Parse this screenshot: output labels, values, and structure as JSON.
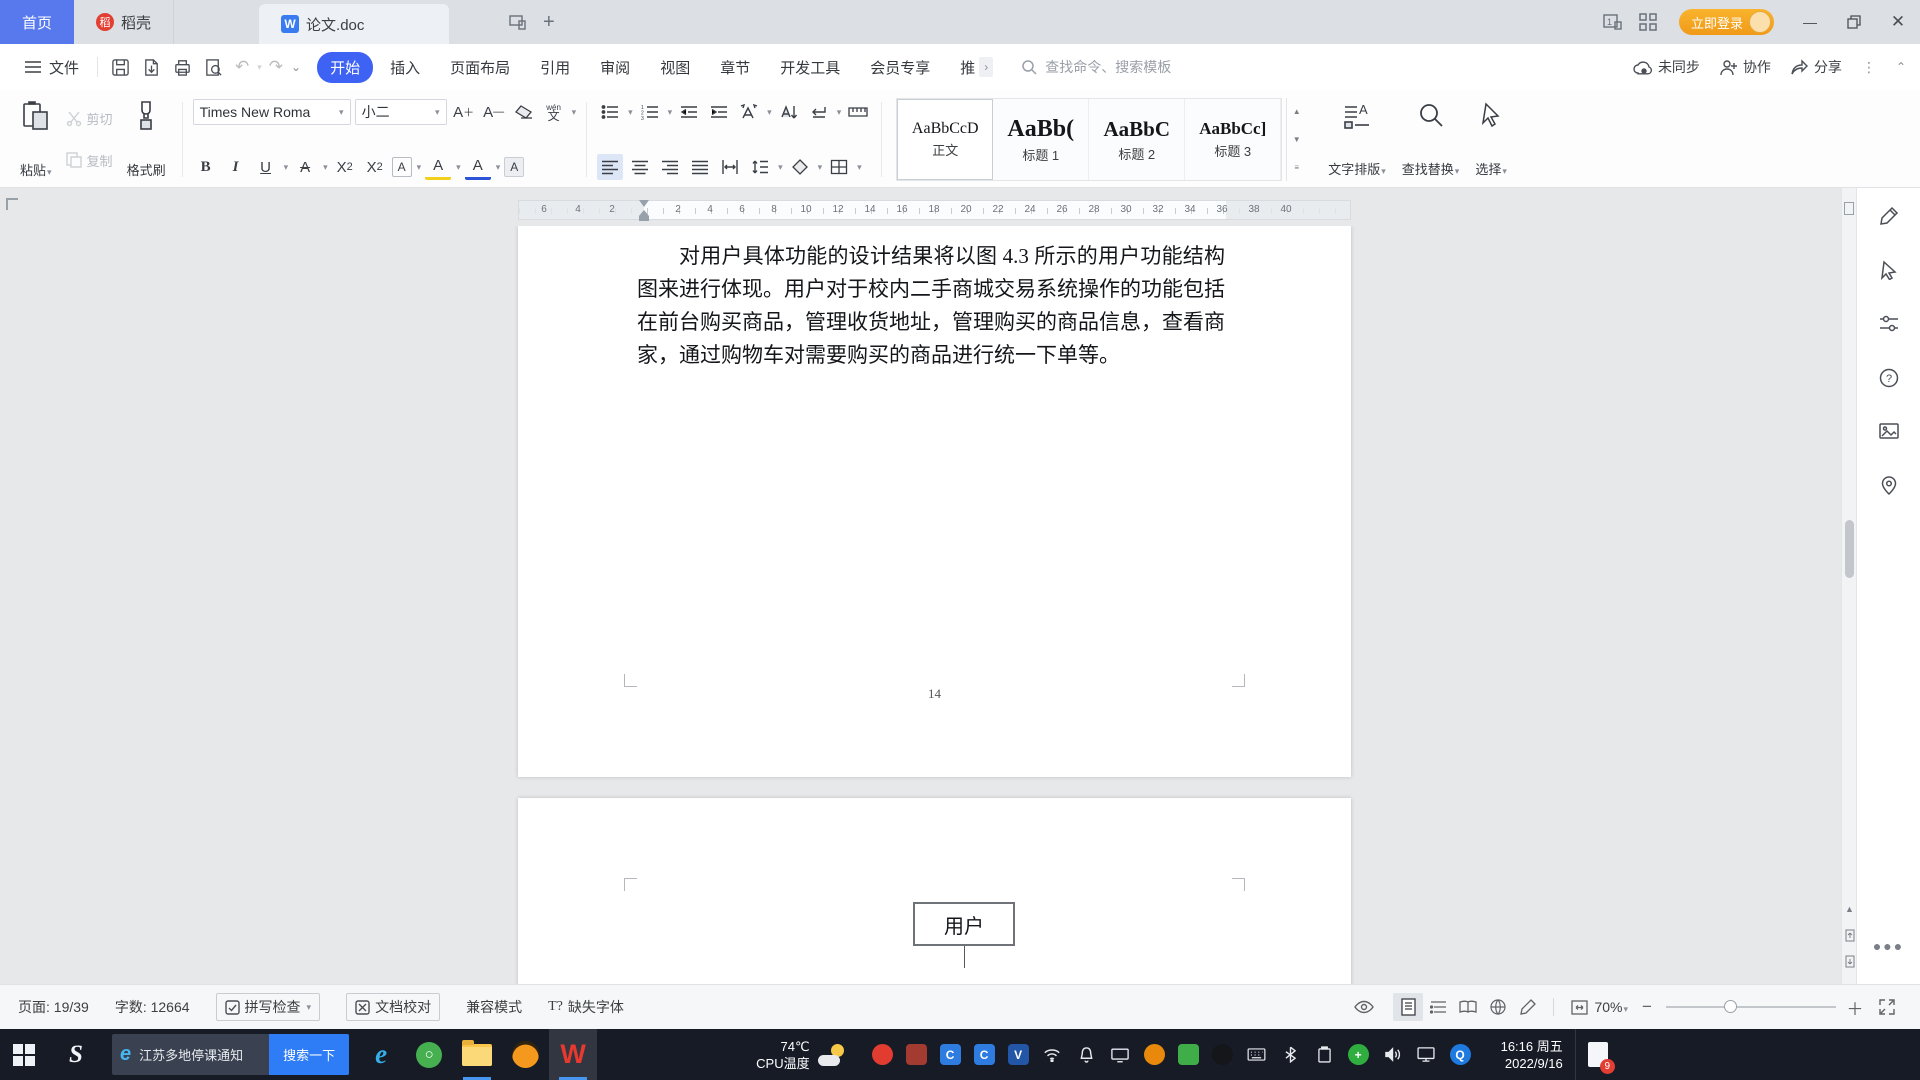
{
  "titlebar": {
    "home_tab": "首页",
    "docer_tab": "稻壳",
    "doc_tab": "论文.doc",
    "login_label": "立即登录"
  },
  "menubar": {
    "file_label": "文件",
    "tabs": [
      "开始",
      "插入",
      "页面布局",
      "引用",
      "审阅",
      "视图",
      "章节",
      "开发工具",
      "会员专享",
      "推"
    ],
    "active_tab": "开始",
    "overflow_indicator": "›",
    "search_placeholder": "查找命令、搜索模板",
    "sync_label": "未同步",
    "collab_label": "协作",
    "share_label": "分享"
  },
  "ribbon": {
    "paste_label": "粘贴",
    "cut_label": "剪切",
    "copy_label": "复制",
    "format_painter_label": "格式刷",
    "font_name": "Times New Roma",
    "font_size": "小二",
    "styles": [
      {
        "preview": "AaBbCcD",
        "label": "正文"
      },
      {
        "preview": "AaBb(",
        "label": "标题 1"
      },
      {
        "preview": "AaBbC",
        "label": "标题 2"
      },
      {
        "preview": "AaBbCc]",
        "label": "标题 3"
      }
    ],
    "typeset_label": "文字排版",
    "find_replace_label": "查找替换",
    "select_label": "选择"
  },
  "ruler": {
    "left_numbers": [
      "6",
      "4",
      "2"
    ],
    "right_numbers": [
      "2",
      "4",
      "6",
      "8",
      "10",
      "12",
      "14",
      "16",
      "18",
      "20",
      "22",
      "24",
      "26",
      "28",
      "30",
      "32",
      "34",
      "36",
      "38",
      "40"
    ]
  },
  "document": {
    "paragraph": "对用户具体功能的设计结果将以图 4.3 所示的用户功能结构图来进行体现。用户对于校内二手商城交易系统操作的功能包括在前台购买商品，管理收货地址，管理购买的商品信息，查看商家，通过购物车对需要购买的商品进行统一下单等。",
    "page_number": "14",
    "diagram_box_label": "用户"
  },
  "statusbar": {
    "page_label": "页面: 19/39",
    "word_count": "字数: 12664",
    "spellcheck_label": "拼写检查",
    "proofread_label": "文档校对",
    "compat_label": "兼容模式",
    "missing_font_prefix": "T?",
    "missing_font_label": "缺失字体",
    "zoom_level": "70%"
  },
  "taskbar": {
    "news_text": "江苏多地停课通知",
    "search_button_label": "搜索一下",
    "temp": "74℃",
    "temp_label": "CPU温度",
    "time": "16:16 周五",
    "date": "2022/9/16",
    "badge_count": "9",
    "tray_icons": [
      {
        "name": "tray-red-messenger-icon",
        "bg": "#e23c31",
        "shape": "circle",
        "glyph": ""
      },
      {
        "name": "tray-maroon-app-icon",
        "bg": "#a33b31",
        "glyph": ""
      },
      {
        "name": "tray-blue-app1-icon",
        "bg": "#2e7ce0",
        "glyph": "C"
      },
      {
        "name": "tray-blue-app2-icon",
        "bg": "#2e7ce0",
        "glyph": "C"
      },
      {
        "name": "tray-security-shield-icon",
        "bg": "#2456a8",
        "glyph": "V"
      },
      {
        "name": "tray-wifi-icon",
        "svg": "wifi"
      },
      {
        "name": "tray-notification-bell-icon",
        "svg": "bell"
      },
      {
        "name": "tray-screen-share-icon",
        "svg": "screen"
      },
      {
        "name": "tray-orange-app-icon",
        "bg": "#e8890c",
        "shape": "circle",
        "glyph": ""
      },
      {
        "name": "tray-green-app-icon",
        "bg": "#3fae49",
        "glyph": ""
      },
      {
        "name": "tray-qq-penguin-icon",
        "bg": "#14161a",
        "shape": "circle",
        "glyph": ""
      },
      {
        "name": "tray-keyboard-icon",
        "svg": "keyboard"
      },
      {
        "name": "tray-bluetooth-icon",
        "svg": "bluetooth"
      },
      {
        "name": "tray-clipboard-icon",
        "svg": "clipboard"
      },
      {
        "name": "tray-green-plus-icon",
        "bg": "#2fae3f",
        "shape": "circle",
        "glyph": "+"
      },
      {
        "name": "tray-volume-icon",
        "svg": "speaker"
      },
      {
        "name": "tray-display-icon",
        "svg": "display"
      },
      {
        "name": "tray-browser-q-icon",
        "bg": "#1f7ae0",
        "shape": "circle",
        "glyph": "Q"
      }
    ]
  },
  "colors": {
    "accent_blue": "#3e62f3",
    "home_tab_blue": "#5878ee",
    "login_orange": "#f7a823",
    "wps_red": "#e23e32",
    "search_button_blue": "#2e7cf6",
    "taskbar_dark": "#161b26"
  }
}
